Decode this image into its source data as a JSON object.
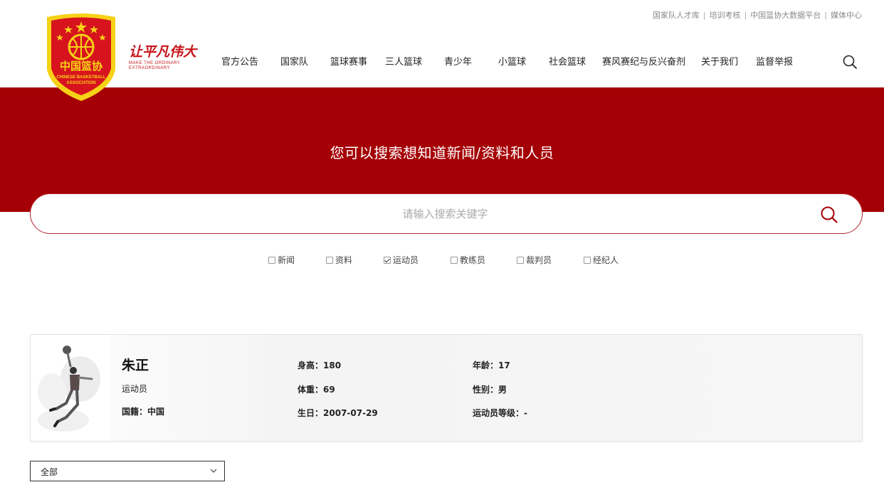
{
  "header": {
    "slogan_cn": "让平凡伟大",
    "slogan_en": "Make the ordinary extraordinary",
    "top_links": [
      "国家队人才库",
      "培训考核",
      "中国篮协大数据平台",
      "媒体中心"
    ],
    "nav": [
      "官方公告",
      "国家队",
      "篮球赛事",
      "三人篮球",
      "青少年",
      "小篮球",
      "社会篮球",
      "赛风赛纪与反兴奋剂",
      "关于我们",
      "监督举报"
    ],
    "logo": {
      "title": "中国篮协",
      "en_line1": "CHINESE BASKETBALL",
      "en_line2": "ASSOCIATION"
    }
  },
  "banner": {
    "title": "您可以搜索想知道新闻/资料和人员"
  },
  "search": {
    "value": "",
    "placeholder": "请输入搜索关键字"
  },
  "filters": [
    {
      "label": "新闻",
      "checked": false
    },
    {
      "label": "资料",
      "checked": false
    },
    {
      "label": "运动员",
      "checked": true
    },
    {
      "label": "教练员",
      "checked": false
    },
    {
      "label": "裁判员",
      "checked": false
    },
    {
      "label": "经纪人",
      "checked": false
    }
  ],
  "result": {
    "name": "朱正",
    "role": "运动员",
    "nationality_label": "国籍：",
    "nationality": "中国",
    "height_label": "身高：",
    "height": "180",
    "weight_label": "体重：",
    "weight": "69",
    "birthday_label": "生日：",
    "birthday": "2007-07-29",
    "age_label": "年龄：",
    "age": "17",
    "gender_label": "性别：",
    "gender": "男",
    "level_label": "运动员等级：",
    "level": "-"
  },
  "dropdown": {
    "selected": "全部"
  },
  "colors": {
    "brand_red": "#a50005",
    "accent_red": "#c8161d",
    "logo_yellow": "#f7d117"
  }
}
